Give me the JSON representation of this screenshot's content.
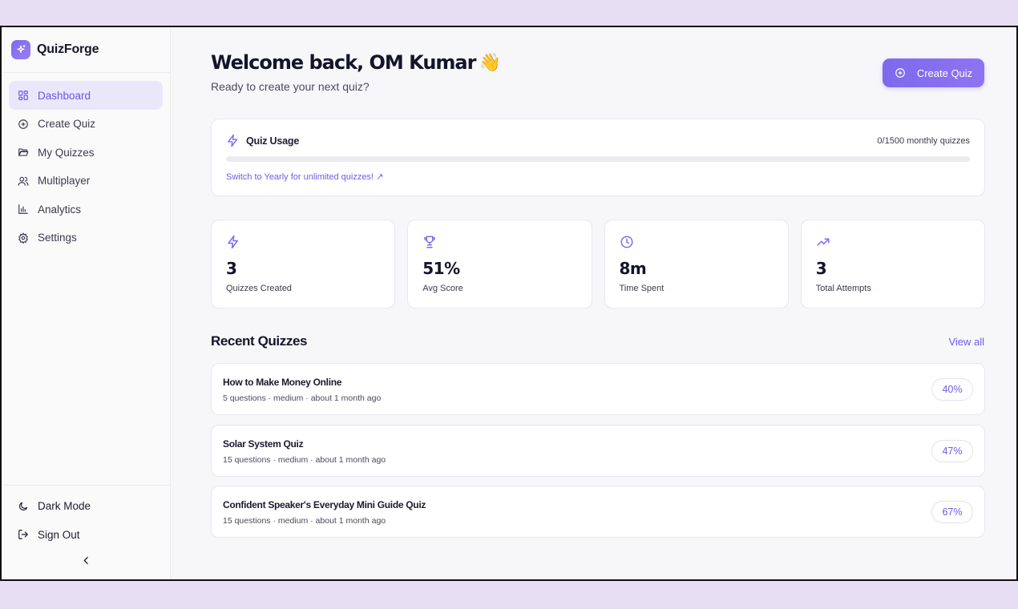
{
  "brand": {
    "name": "QuizForge"
  },
  "sidebar": {
    "items": [
      {
        "label": "Dashboard",
        "icon": "dashboard-icon",
        "active": true
      },
      {
        "label": "Create Quiz",
        "icon": "plus-circle-icon"
      },
      {
        "label": "My Quizzes",
        "icon": "folder-icon"
      },
      {
        "label": "Multiplayer",
        "icon": "users-icon"
      },
      {
        "label": "Analytics",
        "icon": "bar-chart-icon"
      },
      {
        "label": "Settings",
        "icon": "gear-icon"
      }
    ],
    "dark_mode_label": "Dark Mode",
    "sign_out_label": "Sign Out"
  },
  "header": {
    "title": "Welcome back, OM Kumar",
    "emoji": "👋",
    "subtitle": "Ready to create your next quiz?",
    "create_button": "Create Quiz"
  },
  "usage": {
    "title": "Quiz Usage",
    "count": "0/1500 monthly quizzes",
    "progress_fraction": 0,
    "link": "Switch to Yearly for unlimited quizzes! ↗"
  },
  "stats": [
    {
      "value": "3",
      "label": "Quizzes Created",
      "icon": "lightning-icon"
    },
    {
      "value": "51%",
      "label": "Avg Score",
      "icon": "trophy-icon"
    },
    {
      "value": "8m",
      "label": "Time Spent",
      "icon": "clock-icon"
    },
    {
      "value": "3",
      "label": "Total Attempts",
      "icon": "trending-up-icon"
    }
  ],
  "recent": {
    "title": "Recent Quizzes",
    "view_all": "View all",
    "quizzes": [
      {
        "name": "How to Make Money Online",
        "meta": "5 questions · medium · about 1 month ago",
        "score": "40%"
      },
      {
        "name": "Solar System Quiz",
        "meta": "15 questions · medium · about 1 month ago",
        "score": "47%"
      },
      {
        "name": "Confident Speaker's Everyday Mini Guide Quiz",
        "meta": "15 questions · medium · about 1 month ago",
        "score": "67%"
      }
    ]
  },
  "colors": {
    "accent": "#7c6cf0",
    "page_bg": "#e8def3",
    "active_nav_bg": "#ebe7fb"
  }
}
